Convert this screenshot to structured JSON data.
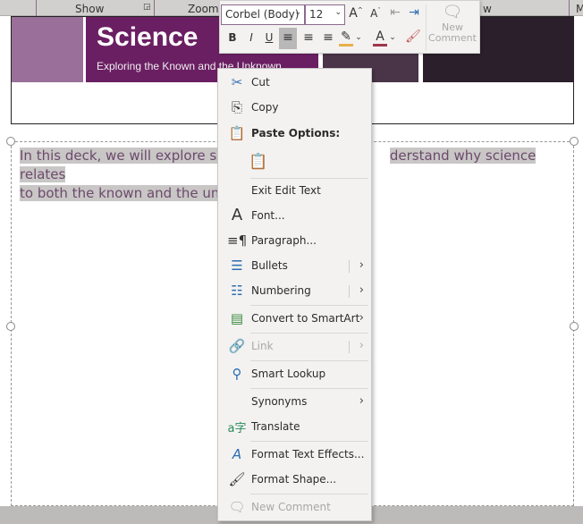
{
  "ribbon": {
    "show": "Show",
    "zoom": "Zoom",
    "view_partial": "w",
    "m_partial": "M"
  },
  "slide": {
    "title": "Science",
    "subtitle": "Exploring the Known and the Unknown",
    "body_line1": "In this deck, we will explore scie",
    "body_line1_end": "derstand why science relates",
    "body_line2": "to both the known and the unk"
  },
  "mini_toolbar": {
    "font": "Corbel (Body)",
    "size": "12",
    "bold": "B",
    "italic": "I",
    "underline": "U",
    "new_comment": "New Comment",
    "highlight_color": "#e8b04a",
    "font_color": "#a0364a"
  },
  "menu": {
    "items": [
      {
        "label": "Cut",
        "icon": "scissors-icon"
      },
      {
        "label": "Copy",
        "icon": "copy-icon"
      },
      {
        "label": "Paste Options:",
        "icon": "paste-icon"
      },
      {
        "label": "Exit Edit Text"
      },
      {
        "label": "Font...",
        "icon": "font-icon"
      },
      {
        "label": "Paragraph...",
        "icon": "paragraph-icon"
      },
      {
        "label": "Bullets",
        "icon": "bullets-icon"
      },
      {
        "label": "Numbering",
        "icon": "numbering-icon"
      },
      {
        "label": "Convert to SmartArt",
        "icon": "smartart-icon"
      },
      {
        "label": "Link",
        "icon": "link-icon",
        "disabled": true
      },
      {
        "label": "Smart Lookup",
        "icon": "smart-lookup-icon"
      },
      {
        "label": "Synonyms"
      },
      {
        "label": "Translate",
        "icon": "translate-icon"
      },
      {
        "label": "Format Text Effects...",
        "icon": "text-effects-icon"
      },
      {
        "label": "Format Shape...",
        "icon": "format-shape-icon"
      },
      {
        "label": "New Comment",
        "icon": "new-comment-icon",
        "disabled": true
      }
    ]
  }
}
